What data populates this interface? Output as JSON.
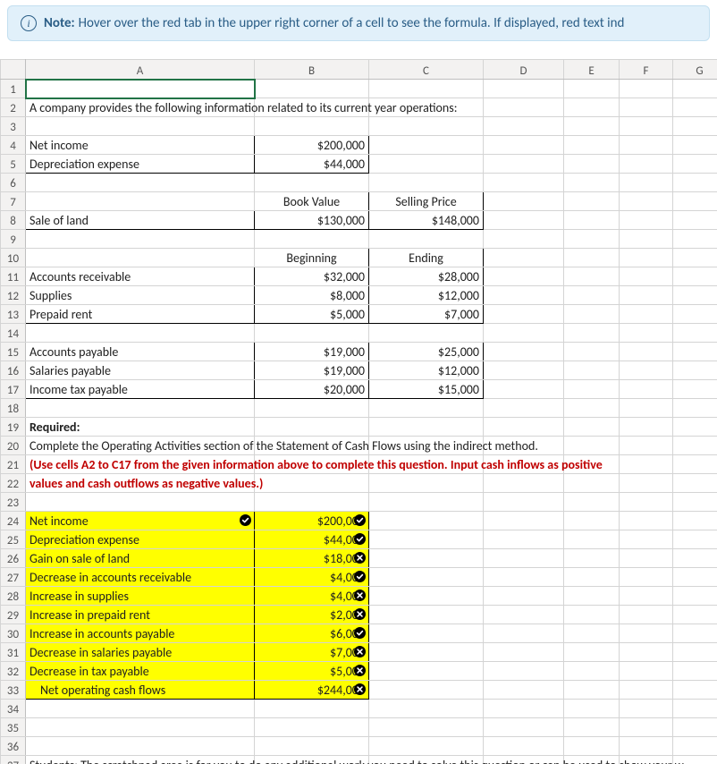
{
  "note": {
    "label": "Note:",
    "text": "Hover over the red tab in the upper right corner of a cell to see the formula. If displayed, red text ind"
  },
  "columns": [
    "A",
    "B",
    "C",
    "D",
    "E",
    "F",
    "G"
  ],
  "rows": {
    "r2A": "A company provides the following information related to its current year operations:",
    "r4A": "Net income",
    "r4B": "$200,000",
    "r5A": "Depreciation expense",
    "r5B": "$44,000",
    "r7B": "Book Value",
    "r7C": "Selling Price",
    "r8A": "Sale of land",
    "r8B": "$130,000",
    "r8C": "$148,000",
    "r10B": "Beginning",
    "r10C": "Ending",
    "r11A": "Accounts receivable",
    "r11B": "$32,000",
    "r11C": "$28,000",
    "r12A": "Supplies",
    "r12B": "$8,000",
    "r12C": "$12,000",
    "r13A": "Prepaid rent",
    "r13B": "$5,000",
    "r13C": "$7,000",
    "r15A": "Accounts payable",
    "r15B": "$19,000",
    "r15C": "$25,000",
    "r16A": "Salaries payable",
    "r16B": "$19,000",
    "r16C": "$12,000",
    "r17A": "Income tax payable",
    "r17B": "$20,000",
    "r17C": "$15,000",
    "r19A": "Required:",
    "r20A": "Complete the Operating Activities section of the Statement of Cash Flows using the indirect method.",
    "r21A": "(Use cells A2 to C17 from the given information above to complete this question. Input cash inflows as positive",
    "r22A": "values and cash outflows as negative values.)",
    "r24A": "Net income",
    "r24B": "$200,000",
    "r25A": "Depreciation expense",
    "r25B": "$44,000",
    "r26A": "Gain on sale of land",
    "r26B": "$18,000",
    "r27A": "Decrease in accounts receivable",
    "r27B": "$4,000",
    "r28A": "Increase in supplies",
    "r28B": "$4,000",
    "r29A": "Increase in prepaid rent",
    "r29B": "$2,000",
    "r30A": "Increase in accounts payable",
    "r30B": "$6,000",
    "r31A": "Decrease in salaries payable",
    "r31B": "$7,000",
    "r32A": "Decrease in tax payable",
    "r32B": "$5,000",
    "r33A": "Net operating cash flows",
    "r33B": "$244,000",
    "r37A": "Students: The scratchpad area is for you to do any additional work you need to solve this question or can be used to show your w"
  },
  "marks": {
    "A24": "green",
    "B24": "green",
    "B25": "green",
    "B26": "red",
    "B27": "green",
    "B28": "red",
    "B29": "red",
    "B30": "green",
    "B31": "red",
    "B32": "red",
    "B33": "red"
  }
}
